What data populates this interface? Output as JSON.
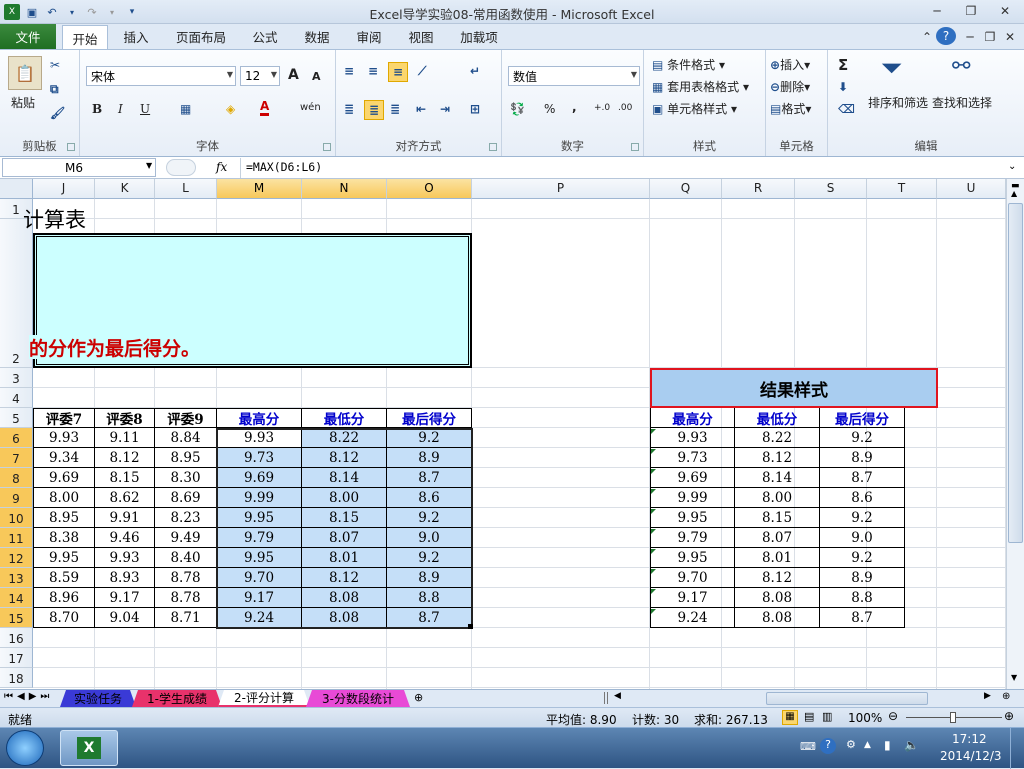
{
  "window": {
    "title": "Excel导学实验08-常用函数使用 - Microsoft Excel"
  },
  "qat": {
    "undo_icon": "undo-icon",
    "redo_icon": "redo-icon",
    "save_icon": "save-icon",
    "customize": "▾"
  },
  "ribbon_tabs": [
    "文件",
    "开始",
    "插入",
    "页面布局",
    "公式",
    "数据",
    "审阅",
    "视图",
    "加载项"
  ],
  "ribbon": {
    "clipboard": {
      "paste": "粘贴",
      "label": "剪贴板"
    },
    "font": {
      "name": "宋体",
      "size": "12",
      "label": "字体",
      "bold": "B",
      "italic": "I",
      "underline": "U",
      "grow": "A",
      "shrink": "A",
      "font_color": "A",
      "phonetic": "wén"
    },
    "alignment": {
      "label": "对齐方式"
    },
    "number": {
      "format": "数值",
      "label": "数字",
      "percent": "%",
      "comma": ",",
      "inc_decimal": "+.0",
      "dec_decimal": ".00"
    },
    "styles": {
      "conditional": "条件格式",
      "table": "套用表格格式",
      "cell": "单元格样式",
      "label": "样式"
    },
    "cells": {
      "insert": "插入",
      "delete": "删除",
      "format": "格式",
      "label": "单元格"
    },
    "editing": {
      "sum": "Σ",
      "sort": "排序和筛选",
      "find": "查找和选择",
      "label": "编辑"
    }
  },
  "formula_bar": {
    "name_box": "M6",
    "fx": "fx",
    "formula": "=MAX(D6:L6)"
  },
  "columns": [
    "J",
    "K",
    "L",
    "M",
    "N",
    "O",
    "P",
    "Q",
    "R",
    "S",
    "T",
    "U"
  ],
  "rows": [
    "1",
    "2",
    "3",
    "4",
    "5",
    "6",
    "7",
    "8",
    "9",
    "10",
    "11",
    "12",
    "13",
    "14",
    "15",
    "16",
    "17",
    "18"
  ],
  "sheet": {
    "title_fragment": "计算表",
    "instruction_fragment": "的分作为最后得分。",
    "left_headers": [
      "评委7",
      "评委8",
      "评委9",
      "最高分",
      "最低分",
      "最后得分"
    ],
    "left_rows": [
      [
        "9.93",
        "9.11",
        "8.84",
        "9.93",
        "8.22",
        "9.2"
      ],
      [
        "9.34",
        "8.12",
        "8.95",
        "9.73",
        "8.12",
        "8.9"
      ],
      [
        "9.69",
        "8.15",
        "8.30",
        "9.69",
        "8.14",
        "8.7"
      ],
      [
        "8.00",
        "8.62",
        "8.69",
        "9.99",
        "8.00",
        "8.6"
      ],
      [
        "8.95",
        "9.91",
        "8.23",
        "9.95",
        "8.15",
        "9.2"
      ],
      [
        "8.38",
        "9.46",
        "9.49",
        "9.79",
        "8.07",
        "9.0"
      ],
      [
        "9.95",
        "9.93",
        "8.40",
        "9.95",
        "8.01",
        "9.2"
      ],
      [
        "8.59",
        "8.93",
        "8.78",
        "9.70",
        "8.12",
        "8.9"
      ],
      [
        "8.96",
        "9.17",
        "8.78",
        "9.17",
        "8.08",
        "8.8"
      ],
      [
        "8.70",
        "9.04",
        "8.71",
        "9.24",
        "8.08",
        "8.7"
      ]
    ],
    "result_title": "结果样式",
    "result_headers": [
      "最高分",
      "最低分",
      "最后得分"
    ],
    "result_rows": [
      [
        "9.93",
        "8.22",
        "9.2"
      ],
      [
        "9.73",
        "8.12",
        "8.9"
      ],
      [
        "9.69",
        "8.14",
        "8.7"
      ],
      [
        "9.99",
        "8.00",
        "8.6"
      ],
      [
        "9.95",
        "8.15",
        "9.2"
      ],
      [
        "9.79",
        "8.07",
        "9.0"
      ],
      [
        "9.95",
        "8.01",
        "9.2"
      ],
      [
        "9.70",
        "8.12",
        "8.9"
      ],
      [
        "9.17",
        "8.08",
        "8.8"
      ],
      [
        "9.24",
        "8.08",
        "8.7"
      ]
    ]
  },
  "sheet_tabs": [
    {
      "label": "实验任务",
      "color": "#3a3ad6"
    },
    {
      "label": "1-学生成绩",
      "color": "#e8326b"
    },
    {
      "label": "2-评分计算",
      "color": "#ffffff"
    },
    {
      "label": "3-分数段统计",
      "color": "#e84ad6"
    }
  ],
  "status": {
    "ready": "就绪",
    "average": "平均值: 8.90",
    "count": "计数: 30",
    "sum": "求和: 267.13",
    "zoom": "100%"
  },
  "taskbar": {
    "time": "17:12",
    "date": "2014/12/3"
  },
  "colors": {
    "accent_blue": "#c5dff8",
    "header_blue": "#0000cc",
    "red_text": "#cc0000",
    "result_border": "#e0141e",
    "instruction_bg": "#ccffff"
  }
}
